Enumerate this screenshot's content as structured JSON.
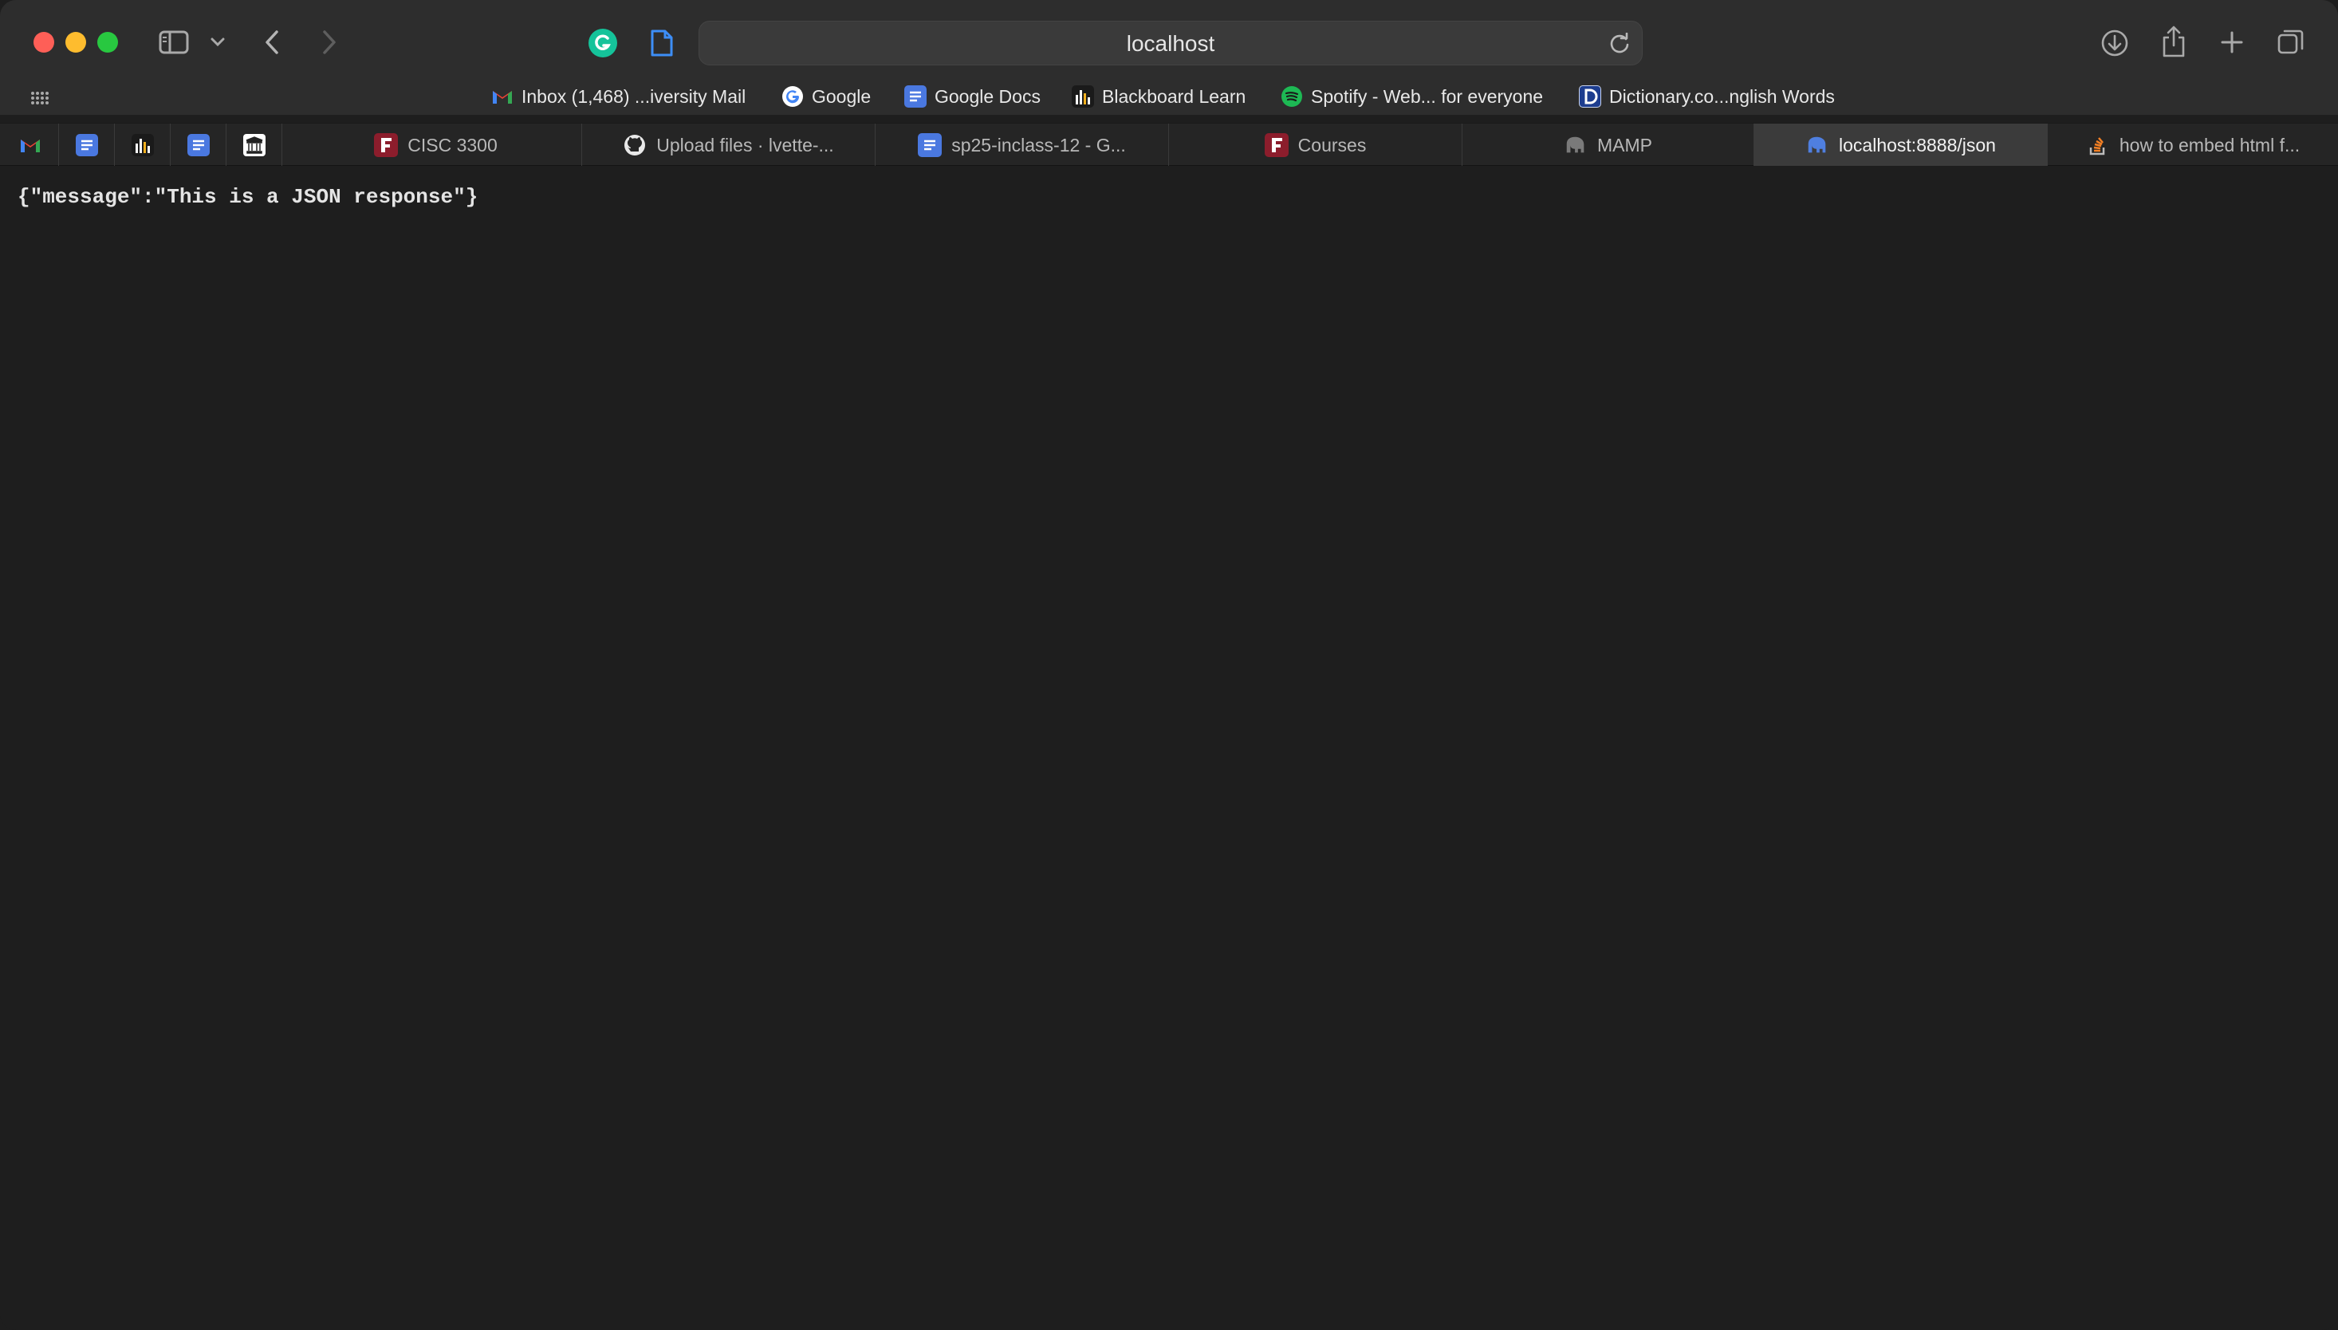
{
  "window": {
    "controls": [
      "close",
      "minimize",
      "zoom"
    ]
  },
  "toolbar": {
    "address": "localhost",
    "icons": [
      "sidebar-icon",
      "chevron-down-icon",
      "back-icon",
      "forward-icon",
      "grammarly-icon",
      "page-icon",
      "reload-icon",
      "download-icon",
      "share-icon",
      "plus-icon",
      "tabs-overview-icon"
    ]
  },
  "bookmarks": [
    {
      "label": "Inbox (1,468) ...iversity Mail",
      "icon": "gmail-icon"
    },
    {
      "label": "Google",
      "icon": "google-icon"
    },
    {
      "label": "Google Docs",
      "icon": "google-docs-icon"
    },
    {
      "label": "Blackboard Learn",
      "icon": "blackboard-icon"
    },
    {
      "label": "Spotify - Web... for everyone",
      "icon": "spotify-icon"
    },
    {
      "label": "Dictionary.co...nglish Words",
      "icon": "dictionary-icon"
    }
  ],
  "pinned_tabs": [
    "gmail-icon",
    "google-docs-icon",
    "chart-icon",
    "google-docs-icon",
    "museum-icon"
  ],
  "tabs": [
    {
      "label": "CISC 3300",
      "icon": "fordham-icon",
      "active": false
    },
    {
      "label": "Upload files · lvette-...",
      "icon": "github-icon",
      "active": false
    },
    {
      "label": "sp25-inclass-12 - G...",
      "icon": "google-docs-icon",
      "active": false
    },
    {
      "label": "Courses",
      "icon": "fordham-icon",
      "active": false
    },
    {
      "label": "MAMP",
      "icon": "elephant-icon",
      "active": false
    },
    {
      "label": "localhost:8888/json",
      "icon": "elephant-icon",
      "active": true
    },
    {
      "label": "how to embed html f...",
      "icon": "stackoverflow-icon",
      "active": false
    }
  ],
  "content": {
    "body_text": "{\"message\":\"This is a JSON response\"}"
  },
  "colors": {
    "toolbar_bg": "#2d2d2d",
    "content_bg": "#1e1e1e",
    "active_tab_bg": "#3b3b3b",
    "close": "#fe5f57",
    "minimize": "#febc2e",
    "zoom": "#28c840"
  }
}
